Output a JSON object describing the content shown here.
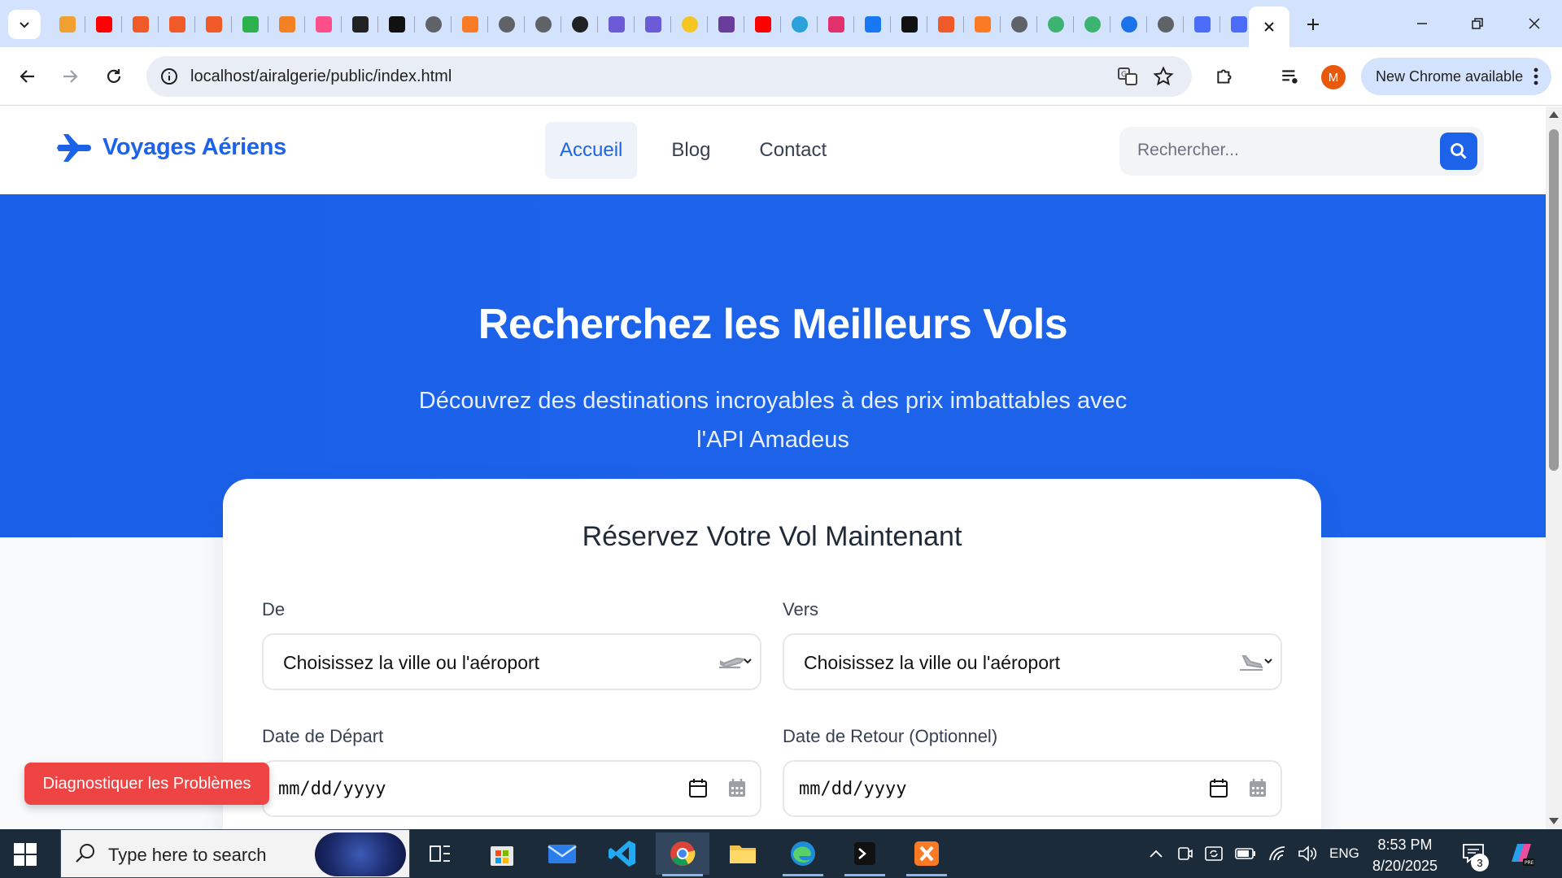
{
  "browser": {
    "url": "localhost/airalgerie/public/index.html",
    "profile_initial": "M",
    "update_label": "New Chrome available",
    "tab_favicons": [
      {
        "name": "pma",
        "color": "#f0a030"
      },
      {
        "name": "youtube",
        "color": "#ff0000"
      },
      {
        "name": "app-orange-1",
        "color": "#f05a28"
      },
      {
        "name": "app-orange-2",
        "color": "#f05a28"
      },
      {
        "name": "app-orange-3",
        "color": "#f05a28"
      },
      {
        "name": "green-app",
        "color": "#2bb24c"
      },
      {
        "name": "stack-app",
        "color": "#f48024"
      },
      {
        "name": "pink-app",
        "color": "#ff4f8b"
      },
      {
        "name": "pause-app",
        "color": "#222222"
      },
      {
        "name": "p-app",
        "color": "#111111"
      },
      {
        "name": "search-tab",
        "color": "#5f6368"
      },
      {
        "name": "xampp",
        "color": "#fb7a24"
      },
      {
        "name": "globe",
        "color": "#5f6368"
      },
      {
        "name": "search-tab-2",
        "color": "#5f6368"
      },
      {
        "name": "openai",
        "color": "#202123"
      },
      {
        "name": "meta-1",
        "color": "#6b5bd6"
      },
      {
        "name": "meta-2",
        "color": "#6b5bd6"
      },
      {
        "name": "clock-app",
        "color": "#f3c623"
      },
      {
        "name": "slack-like",
        "color": "#6a3d9a"
      },
      {
        "name": "youtube-2",
        "color": "#ff0000"
      },
      {
        "name": "telegram",
        "color": "#2aa1da"
      },
      {
        "name": "instagram",
        "color": "#e1306c"
      },
      {
        "name": "facebook",
        "color": "#1877f2"
      },
      {
        "name": "tiktok",
        "color": "#111111"
      },
      {
        "name": "app-orange-4",
        "color": "#f05a28"
      },
      {
        "name": "xampp-2",
        "color": "#fb7a24"
      },
      {
        "name": "search-tab-3",
        "color": "#5f6368"
      },
      {
        "name": "copilot-1",
        "color": "#3cb371"
      },
      {
        "name": "copilot-2",
        "color": "#3cb371"
      },
      {
        "name": "notif-app",
        "color": "#1a73e8"
      },
      {
        "name": "search-tab-4",
        "color": "#5f6368"
      },
      {
        "name": "bird-1",
        "color": "#4a6cf7"
      },
      {
        "name": "bird-2",
        "color": "#4a6cf7"
      }
    ]
  },
  "site": {
    "brand": "Voyages Aériens",
    "nav": [
      {
        "label": "Accueil",
        "active": true
      },
      {
        "label": "Blog",
        "active": false
      },
      {
        "label": "Contact",
        "active": false
      }
    ],
    "search_placeholder": "Rechercher...",
    "hero_title": "Recherchez les Meilleurs Vols",
    "hero_subtitle": "Découvrez des destinations incroyables à des prix imbattables avec l'API Amadeus",
    "booking": {
      "title": "Réservez Votre Vol Maintenant",
      "from_label": "De",
      "from_value": "Choisissez la ville ou l'aéroport",
      "to_label": "Vers",
      "to_value": "Choisissez la ville ou l'aéroport",
      "depart_label": "Date de Départ",
      "depart_value": "mm/dd/yyyy",
      "return_label": "Date de Retour (Optionnel)",
      "return_value": "mm/dd/yyyy"
    },
    "diagnose_button": "Diagnostiquer les Problèmes",
    "colors": {
      "primary": "#1d63ea",
      "danger": "#ef4444"
    }
  },
  "taskbar": {
    "search_placeholder": "Type here to search",
    "language": "ENG",
    "time": "8:53 PM",
    "date": "8/20/2025",
    "notification_count": "3"
  }
}
